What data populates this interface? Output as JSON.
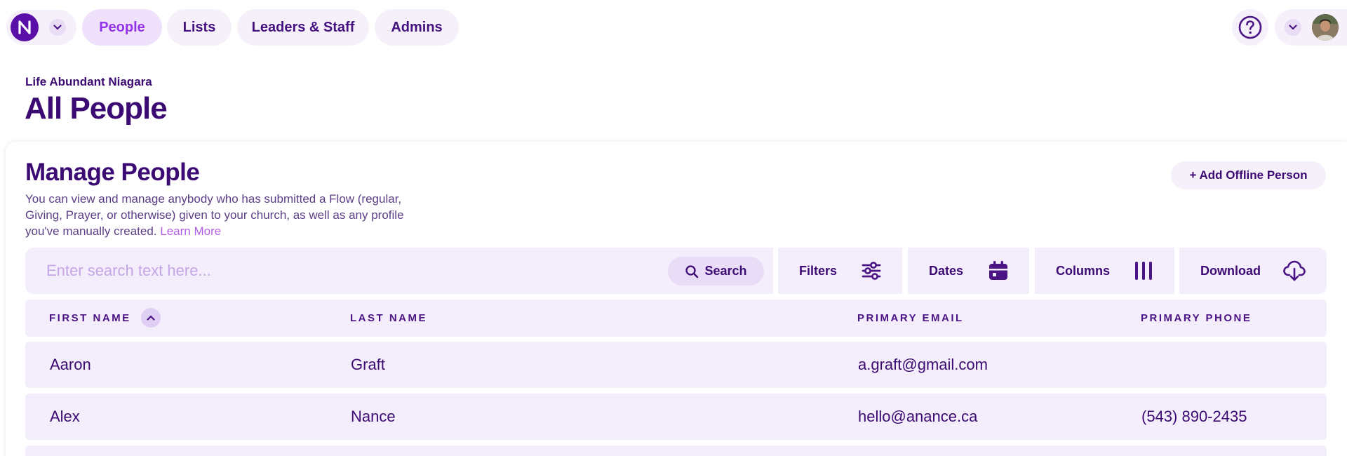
{
  "nav": {
    "tabs": [
      {
        "label": "People",
        "active": true
      },
      {
        "label": "Lists",
        "active": false
      },
      {
        "label": "Leaders & Staff",
        "active": false
      },
      {
        "label": "Admins",
        "active": false
      }
    ],
    "org_logo_icon": "logo-n-icon",
    "help_icon": "help-icon"
  },
  "header": {
    "church_name": "Life Abundant Niagara",
    "page_title": "All People"
  },
  "section": {
    "title": "Manage People",
    "description": "You can view and manage anybody who has submitted a Flow (regular, Giving, Prayer, or otherwise) given to your church, as well as any profile you've manually created.",
    "learn_more": "Learn More",
    "add_button": "+ Add Offline Person"
  },
  "toolbar": {
    "search_placeholder": "Enter search text here...",
    "search_value": "",
    "search_button": "Search",
    "filters": "Filters",
    "dates": "Dates",
    "columns": "Columns",
    "download": "Download"
  },
  "table": {
    "headers": [
      "FIRST NAME",
      "LAST NAME",
      "PRIMARY EMAIL",
      "PRIMARY PHONE"
    ],
    "sorted_column": "FIRST NAME",
    "sort_direction": "ascending",
    "rows": [
      {
        "first": "Aaron",
        "last": "Graft",
        "email": "a.graft@gmail.com",
        "phone": ""
      },
      {
        "first": "Alex",
        "last": "Nance",
        "email": "hello@anance.ca",
        "phone": "(543) 890-2435"
      },
      {
        "first": "",
        "last": "",
        "email": "",
        "phone": ""
      }
    ]
  },
  "colors": {
    "primary": "#3b0a72",
    "accent": "#9333ea",
    "surface": "#f4edfc",
    "link": "#b45ee8",
    "logo": "#5a0fa8"
  }
}
